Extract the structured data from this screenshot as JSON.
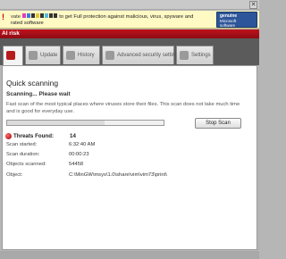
{
  "top_bar": {
    "close_label": "✕"
  },
  "warning_bar": {
    "line1_suffix": "to get Full protection against malicious, virus, spyware and",
    "line2": "rated software",
    "badge_line1": "genuine",
    "badge_line2": "Microsoft",
    "badge_line3": "software"
  },
  "risk_bar": {
    "text": "AI risk"
  },
  "tabs": [
    {
      "label": "",
      "icon": "status-icon",
      "active": true
    },
    {
      "label": "Update",
      "icon": "update-icon"
    },
    {
      "label": "History",
      "icon": "history-icon"
    },
    {
      "label": "Advanced security settings",
      "icon": "advanced-settings-icon"
    },
    {
      "label": "Settings",
      "icon": "settings-icon"
    }
  ],
  "scan": {
    "title": "Quick scanning",
    "status": "Scanning... Please wait",
    "description": "Fast scan of the most typical places where viruses store their files. This scan does not take much time and is good for everyday use.",
    "progress": 0.62,
    "stop_label": "Stop Scan",
    "threats_label": "Threats Found:",
    "threats_value": "14",
    "stats": {
      "started_label": "Scan started:",
      "started_value": "6:32:40 AM",
      "duration_label": "Scan duration:",
      "duration_value": "00:00:23",
      "objects_label": "Objects scanned:",
      "objects_value": "54458",
      "object_label": "Object:",
      "object_value": "C:\\MinGW\\msys\\1.0\\share\\vim\\vim73\\print\\"
    }
  },
  "colors": {
    "risk_red": "#b3111b",
    "warning_yellow": "#fff9c4",
    "frame_grey": "#5b5b5b",
    "badge_blue": "#2d5599"
  }
}
